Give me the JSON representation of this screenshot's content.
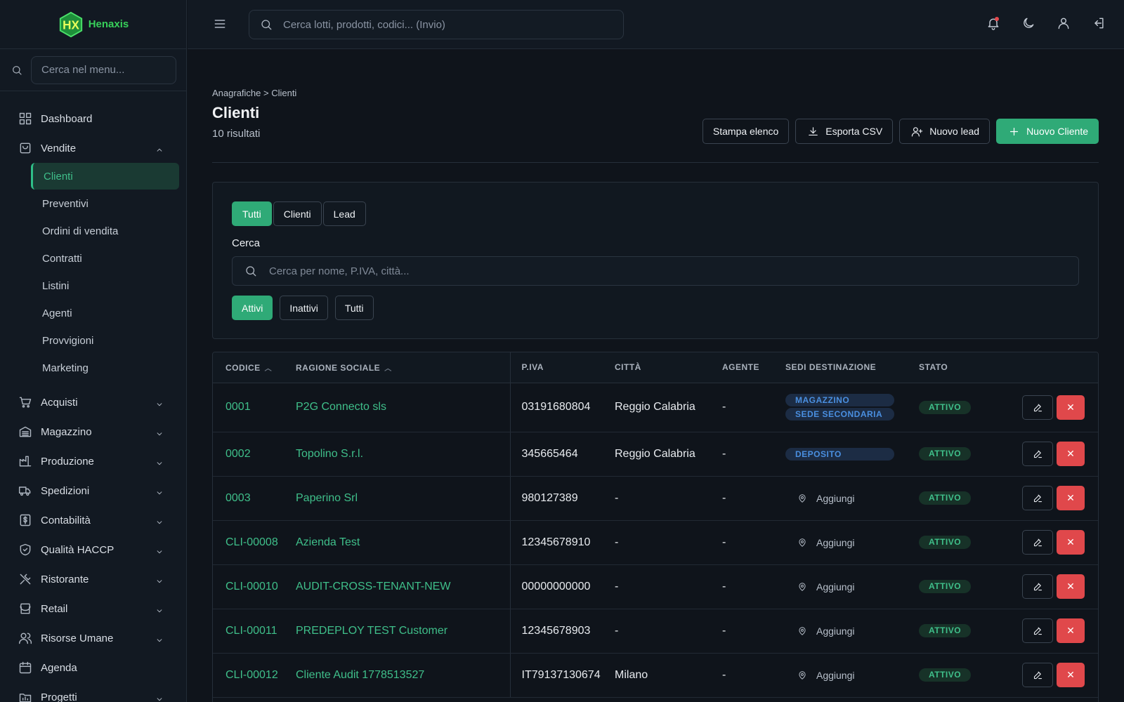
{
  "brand": {
    "name": "Henaxis",
    "logo_text": "HX"
  },
  "sidebar": {
    "search_placeholder": "Cerca nel menu...",
    "items": [
      {
        "label": "Dashboard",
        "icon": "dashboard-icon"
      },
      {
        "label": "Vendite",
        "icon": "bag-icon",
        "expanded": true,
        "children": [
          "Clienti",
          "Preventivi",
          "Ordini di vendita",
          "Contratti",
          "Listini",
          "Agenti",
          "Provvigioni",
          "Marketing"
        ],
        "active_child": "Clienti"
      },
      {
        "label": "Acquisti",
        "icon": "cart-icon"
      },
      {
        "label": "Magazzino",
        "icon": "warehouse-icon"
      },
      {
        "label": "Produzione",
        "icon": "factory-icon"
      },
      {
        "label": "Spedizioni",
        "icon": "truck-icon"
      },
      {
        "label": "Contabilità",
        "icon": "accounting-icon"
      },
      {
        "label": "Qualità HACCP",
        "icon": "shield-icon"
      },
      {
        "label": "Ristorante",
        "icon": "utensils-icon"
      },
      {
        "label": "Retail",
        "icon": "store-icon"
      },
      {
        "label": "Risorse Umane",
        "icon": "users-icon"
      },
      {
        "label": "Agenda",
        "icon": "calendar-icon"
      },
      {
        "label": "Progetti",
        "icon": "projects-icon"
      }
    ]
  },
  "topbar": {
    "search_placeholder": "Cerca lotti, prodotti, codici... (Invio)"
  },
  "page": {
    "breadcrumb": "Anagrafiche > Clienti",
    "title": "Clienti",
    "results": "10 risultati",
    "actions": {
      "print": "Stampa elenco",
      "export": "Esporta CSV",
      "new_lead": "Nuovo lead",
      "new_client": "Nuovo Cliente"
    }
  },
  "filters": {
    "type_tabs": [
      "Tutti",
      "Clienti",
      "Lead"
    ],
    "type_active": "Tutti",
    "search_label": "Cerca",
    "search_placeholder": "Cerca per nome, P.IVA, città...",
    "status_tabs": [
      "Attivi",
      "Inattivi",
      "Tutti"
    ],
    "status_active": "Attivi"
  },
  "table": {
    "headers": {
      "code": "CODICE",
      "name": "RAGIONE SOCIALE",
      "piva": "P.IVA",
      "city": "CITTÀ",
      "agent": "AGENTE",
      "sedi": "SEDI DESTINAZIONE",
      "status": "STATO"
    },
    "add_label": "Aggiungi",
    "rows": [
      {
        "code": "0001",
        "name": "P2G Connecto sls",
        "piva": "03191680804",
        "city": "Reggio Calabria",
        "agent": "-",
        "sedi": [
          "MAGAZZINO",
          "SEDE SECONDARIA"
        ],
        "status": "ATTIVO"
      },
      {
        "code": "0002",
        "name": "Topolino S.r.l.",
        "piva": "345665464",
        "city": "Reggio Calabria",
        "agent": "-",
        "sedi": [
          "DEPOSITO"
        ],
        "status": "ATTIVO"
      },
      {
        "code": "0003",
        "name": "Paperino Srl",
        "piva": "980127389",
        "city": "-",
        "agent": "-",
        "sedi": [],
        "status": "ATTIVO"
      },
      {
        "code": "CLI-00008",
        "name": "Azienda Test",
        "piva": "12345678910",
        "city": "-",
        "agent": "-",
        "sedi": [],
        "status": "ATTIVO"
      },
      {
        "code": "CLI-00010",
        "name": "AUDIT-CROSS-TENANT-NEW",
        "piva": "00000000000",
        "city": "-",
        "agent": "-",
        "sedi": [],
        "status": "ATTIVO"
      },
      {
        "code": "CLI-00011",
        "name": "PREDEPLOY TEST Customer",
        "piva": "12345678903",
        "city": "-",
        "agent": "-",
        "sedi": [],
        "status": "ATTIVO"
      },
      {
        "code": "CLI-00012",
        "name": "Cliente Audit 1778513527",
        "piva": "IT79137130674",
        "city": "Milano",
        "agent": "-",
        "sedi": [],
        "status": "ATTIVO"
      }
    ]
  }
}
